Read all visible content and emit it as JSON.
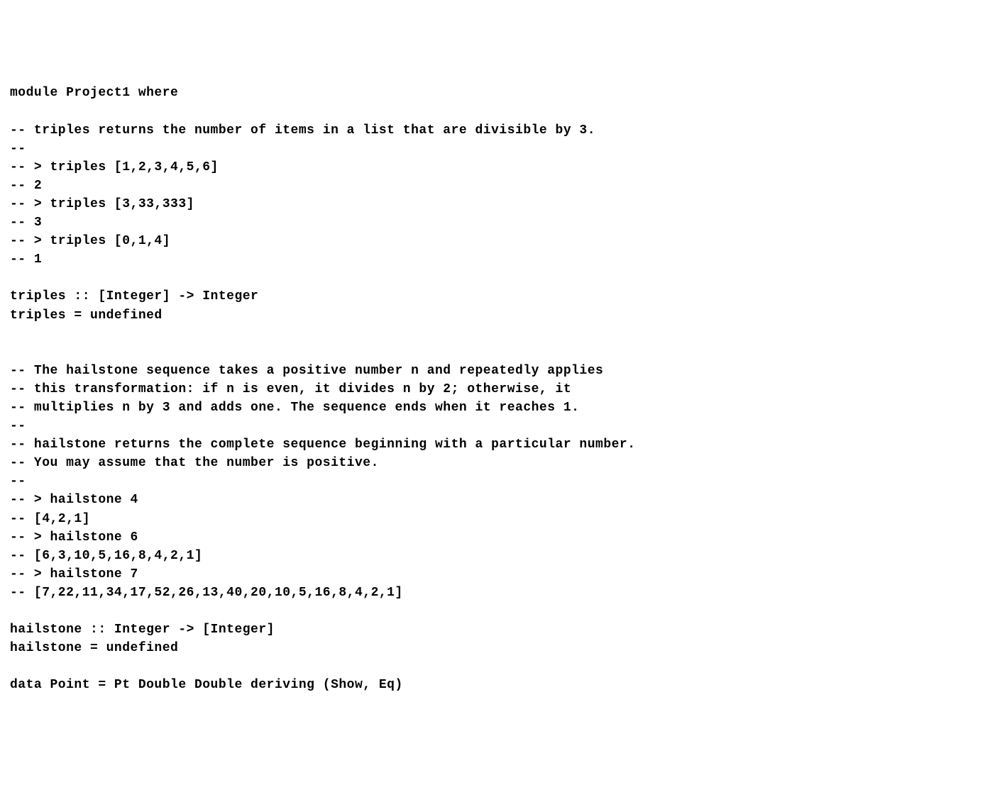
{
  "code": {
    "lines": [
      "module Project1 where",
      "",
      "-- triples returns the number of items in a list that are divisible by 3.",
      "--",
      "-- > triples [1,2,3,4,5,6]",
      "-- 2",
      "-- > triples [3,33,333]",
      "-- 3",
      "-- > triples [0,1,4]",
      "-- 1",
      "",
      "triples :: [Integer] -> Integer",
      "triples = undefined",
      "",
      "",
      "-- The hailstone sequence takes a positive number n and repeatedly applies",
      "-- this transformation: if n is even, it divides n by 2; otherwise, it",
      "-- multiplies n by 3 and adds one. The sequence ends when it reaches 1.",
      "--",
      "-- hailstone returns the complete sequence beginning with a particular number.",
      "-- You may assume that the number is positive.",
      "--",
      "-- > hailstone 4",
      "-- [4,2,1]",
      "-- > hailstone 6",
      "-- [6,3,10,5,16,8,4,2,1]",
      "-- > hailstone 7",
      "-- [7,22,11,34,17,52,26,13,40,20,10,5,16,8,4,2,1]",
      "",
      "hailstone :: Integer -> [Integer]",
      "hailstone = undefined",
      "",
      "data Point = Pt Double Double deriving (Show, Eq)"
    ]
  }
}
